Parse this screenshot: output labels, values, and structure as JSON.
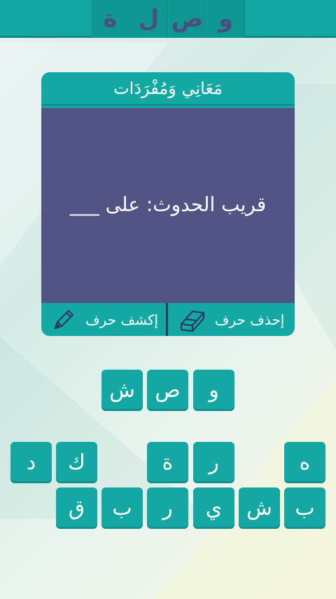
{
  "logo": {
    "letters": [
      "و",
      "ص",
      "ل",
      "ة"
    ]
  },
  "card": {
    "title": "مَعَانِي وَمُفْرَدَات",
    "question": "قريب الحدوث: على ___",
    "reveal_label": "إكشف حرف",
    "delete_label": "إحذف حرف"
  },
  "answer_tiles": [
    "و",
    "ص",
    "ش"
  ],
  "letter_rows": {
    "row1": [
      "ه",
      "ر",
      "ة",
      "ك",
      "د"
    ],
    "row2": [
      "ب",
      "ش",
      "ي",
      "ر",
      "ب",
      "ق"
    ]
  },
  "icons": {
    "reveal": "pencil-icon",
    "delete": "eraser-icon"
  },
  "colors": {
    "teal": "#14a6a3",
    "card_body": "#515484",
    "logo_letter": "#4a4f80"
  }
}
